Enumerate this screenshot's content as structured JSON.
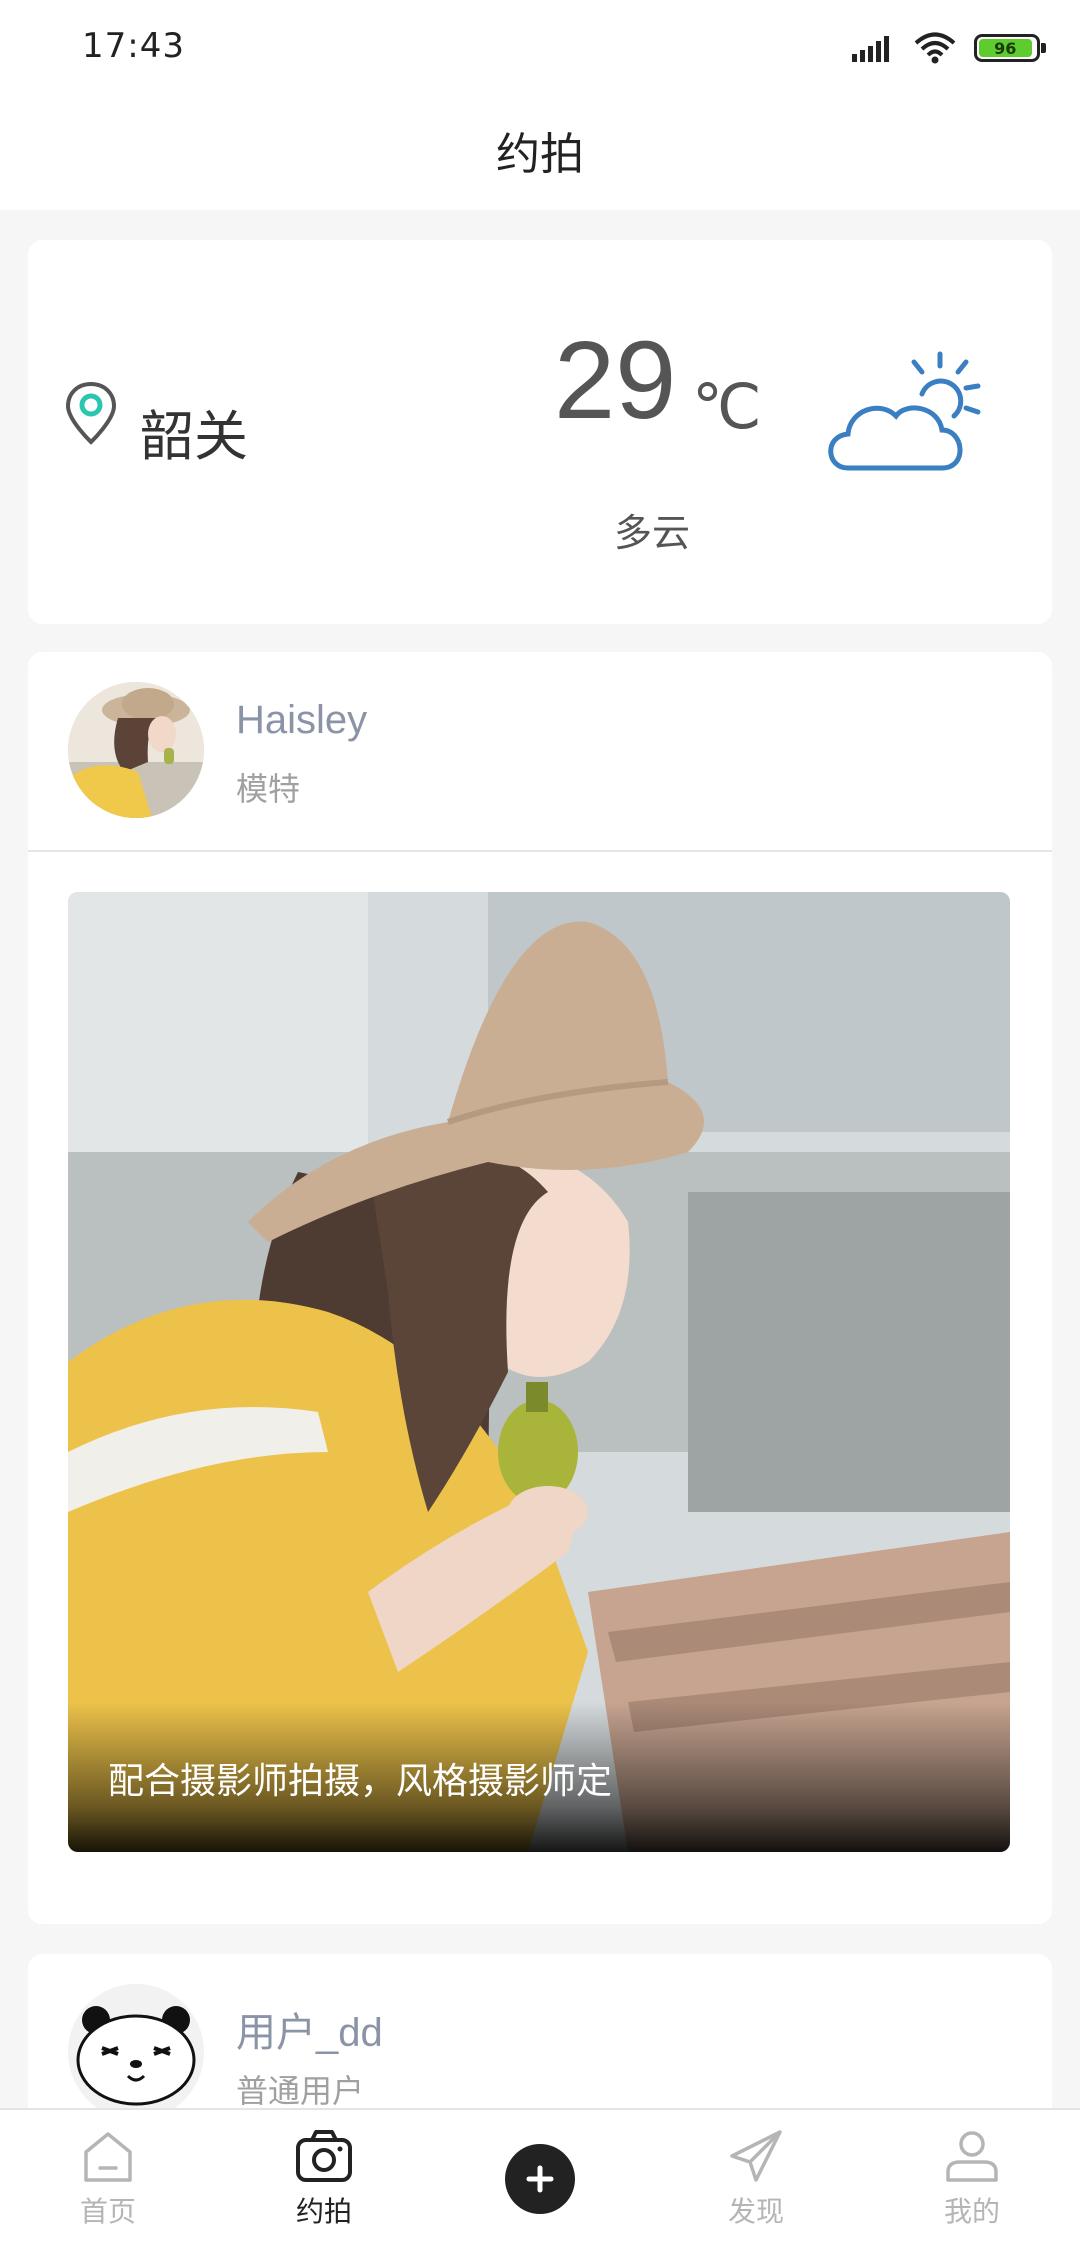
{
  "status_bar": {
    "time": "17:43",
    "battery": "96"
  },
  "header": {
    "title": "约拍"
  },
  "weather": {
    "city": "韶关",
    "temperature": "29",
    "unit": "℃",
    "condition": "多云",
    "icon": "partly-cloudy-icon"
  },
  "posts": [
    {
      "username": "Haisley",
      "role": "模特",
      "caption": "配合摄影师拍摄，风格摄影师定"
    },
    {
      "username": "用户_dd",
      "role": "普通用户"
    }
  ],
  "nav": {
    "items": [
      {
        "label": "首页",
        "icon": "home-icon"
      },
      {
        "label": "约拍",
        "icon": "camera-icon",
        "active": true
      },
      {
        "label": "",
        "icon": "add-icon"
      },
      {
        "label": "发现",
        "icon": "paper-plane-icon"
      },
      {
        "label": "我的",
        "icon": "user-icon"
      }
    ]
  },
  "colors": {
    "accent": "#222222",
    "location_pin": "#2bc6b0",
    "weather_icon": "#3a7fc1",
    "username": "#8a94a6",
    "battery": "#5ecb2f"
  }
}
